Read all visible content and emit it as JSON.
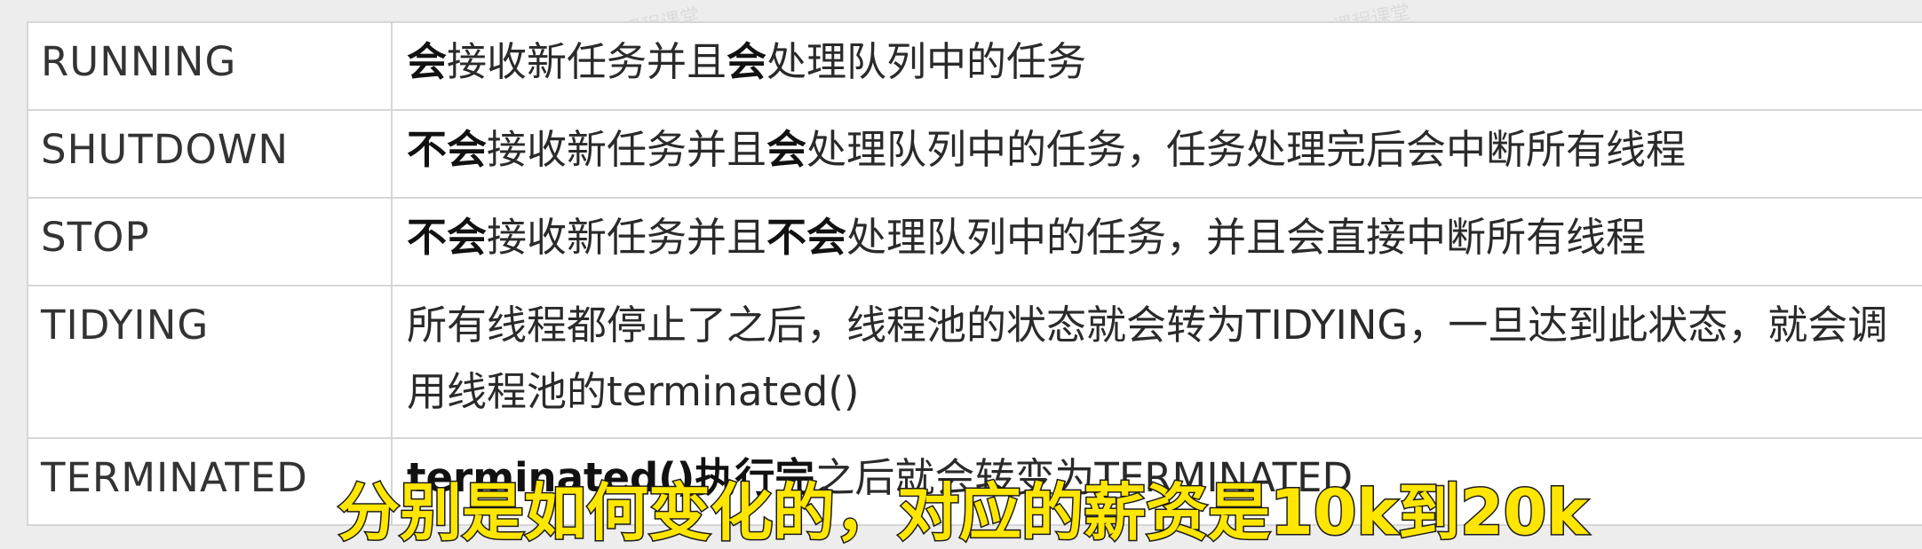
{
  "watermarks": [
    "课程课堂",
    "课程课堂"
  ],
  "rows": [
    {
      "state": "RUNNING",
      "parts": [
        {
          "text": "会",
          "bold": true
        },
        {
          "text": "接收新任务并且",
          "bold": false
        },
        {
          "text": "会",
          "bold": true
        },
        {
          "text": "处理队列中的任务",
          "bold": false
        }
      ]
    },
    {
      "state": "SHUTDOWN",
      "parts": [
        {
          "text": "不会",
          "bold": true
        },
        {
          "text": "接收新任务并且",
          "bold": false
        },
        {
          "text": "会",
          "bold": true
        },
        {
          "text": "处理队列中的任务，任务处理完后会中断所有线程",
          "bold": false
        }
      ]
    },
    {
      "state": "STOP",
      "parts": [
        {
          "text": "不会",
          "bold": true
        },
        {
          "text": "接收新任务并且",
          "bold": false
        },
        {
          "text": "不会",
          "bold": true
        },
        {
          "text": "处理队列中的任务，并且会直接中断所有线程",
          "bold": false
        }
      ]
    },
    {
      "state": "TIDYING",
      "parts": [
        {
          "text": "所有线程都停止了之后，线程池的状态就会转为TIDYING，一旦达到此状态，就会调用线程池的terminated()",
          "bold": false
        }
      ]
    },
    {
      "state": "TERMINATED",
      "parts": [
        {
          "text": "terminated()执行完",
          "bold": true
        },
        {
          "text": "之后就会转变为TERMINATED",
          "bold": false
        }
      ]
    }
  ],
  "subtitle": "分别是如何变化的，对应的薪资是10k到20k"
}
